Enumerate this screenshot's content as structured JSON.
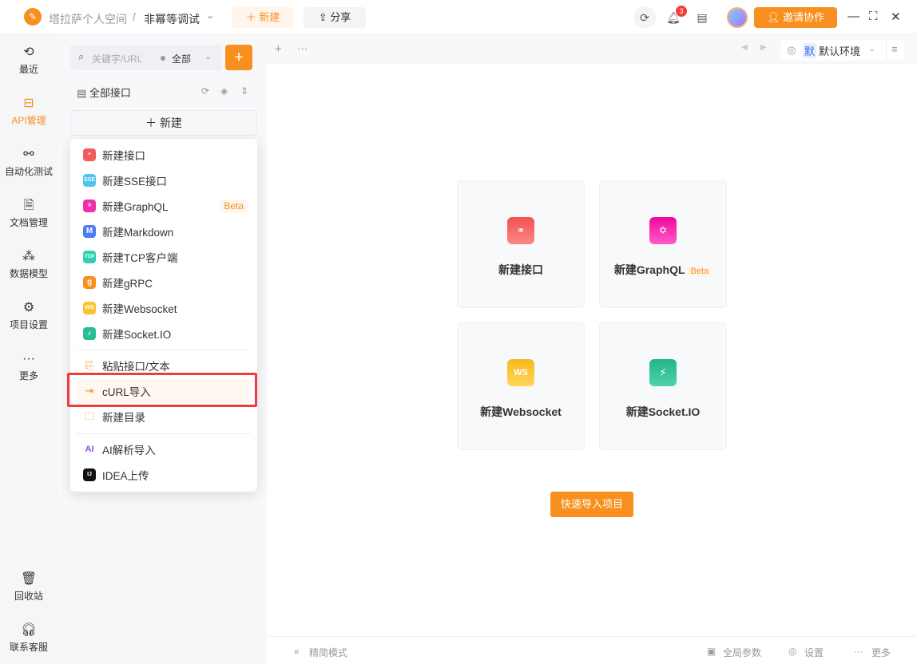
{
  "topbar": {
    "workspace": "塔拉萨个人空间",
    "separator": "/",
    "project": "非幂等调试",
    "new_label": "新建",
    "share_label": "分享",
    "notification_count": "3",
    "invite_label": "邀请协作"
  },
  "nav": [
    {
      "label": "最近",
      "icon": "history-icon"
    },
    {
      "label": "API管理",
      "icon": "api-icon",
      "active": true
    },
    {
      "label": "自动化测试",
      "icon": "flow-icon"
    },
    {
      "label": "文档管理",
      "icon": "doc-icon"
    },
    {
      "label": "数据模型",
      "icon": "model-icon"
    },
    {
      "label": "项目设置",
      "icon": "settings-icon"
    },
    {
      "label": "更多",
      "icon": "more-icon"
    },
    {
      "label": "回收站",
      "icon": "trash-icon"
    },
    {
      "label": "联系客服",
      "icon": "headset-icon"
    }
  ],
  "sidebar": {
    "search_placeholder": "关键字/URL",
    "filter": "全部",
    "tree_title": "全部接口",
    "new_label": "新建"
  },
  "menu": {
    "items": [
      {
        "label": "新建接口",
        "icon_text": "⚭",
        "color": "#f25c5c"
      },
      {
        "label": "新建SSE接口",
        "icon_text": "SSE",
        "color": "#4cc3f0"
      },
      {
        "label": "新建GraphQL",
        "icon_text": "✡",
        "color": "#f02fa8",
        "badge": "Beta"
      },
      {
        "label": "新建Markdown",
        "icon_text": "M",
        "color": "#4a7cf6"
      },
      {
        "label": "新建TCP客户端",
        "icon_text": "TCP",
        "color": "#2fd1b4"
      },
      {
        "label": "新建gRPC",
        "icon_text": "g",
        "color": "#f7901e"
      },
      {
        "label": "新建Websocket",
        "icon_text": "WS",
        "color": "#f9c22e"
      },
      {
        "label": "新建Socket.IO",
        "icon_text": "⚡",
        "color": "#2bbd95"
      },
      {
        "label": "粘贴接口/文本"
      },
      {
        "label": "cURL导入"
      },
      {
        "label": "新建目录"
      },
      {
        "label": "AI解析导入",
        "icon_text": "AI"
      },
      {
        "label": "IDEA上传",
        "icon_text": "IJ"
      }
    ]
  },
  "env": {
    "badge": "默",
    "label": "默认环境"
  },
  "cards": [
    {
      "label": "新建接口",
      "color": "#f25c5c"
    },
    {
      "label": "新建GraphQL",
      "badge": "Beta",
      "color": "#f02fa8"
    },
    {
      "label": "新建Websocket",
      "icon_text": "WS",
      "color": "#f9c22e"
    },
    {
      "label": "新建Socket.IO",
      "color": "#2bbd95"
    }
  ],
  "quick_import": "快速导入项目",
  "footer": {
    "compact": "精简模式",
    "global_params": "全局参数",
    "settings": "设置",
    "more": "更多"
  }
}
